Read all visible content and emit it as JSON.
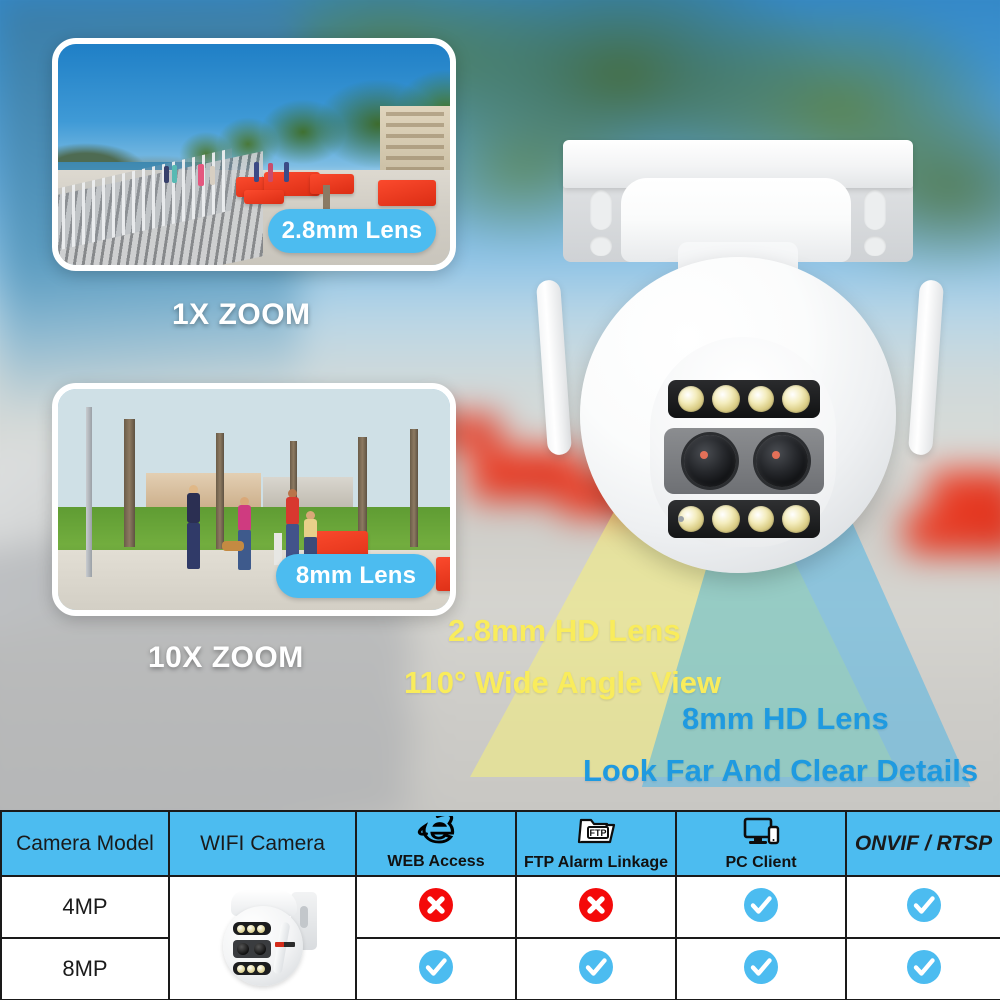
{
  "hero": {
    "previews": [
      {
        "id": "1x",
        "zoom_label": "1X ZOOM",
        "pill_label": "2.8mm Lens",
        "scene": "riverside promenade with boardwalk, red lounge furniture and trees"
      },
      {
        "id": "10x",
        "zoom_label": "10X ZOOM",
        "pill_label": "8mm Lens",
        "scene": "park lawn with people walking, trees and red bench"
      }
    ],
    "callouts": [
      {
        "text": "2.8mm HD Lens",
        "color": "#f9ec5c"
      },
      {
        "text": "110° Wide Angle View",
        "color": "#f9ec5c"
      },
      {
        "text": "8mm HD Lens",
        "color": "#1f9ae0"
      },
      {
        "text": "Look Far And Clear Details",
        "color": "#1f9ae0"
      }
    ],
    "cones": [
      {
        "name": "wide-angle-beam",
        "color": "#f6f07a"
      },
      {
        "name": "telephoto-beam",
        "color": "#46b3e8"
      }
    ],
    "camera": {
      "name": "dual-lens-ptz-wifi-camera",
      "body_color": "#ffffff"
    }
  },
  "table": {
    "headers": [
      {
        "label": "Camera Model",
        "icon": null,
        "icon_label": null,
        "style": "plain"
      },
      {
        "label": "WIFI Camera",
        "icon": null,
        "icon_label": null,
        "style": "plain"
      },
      {
        "label": "WEB Access",
        "icon": "ie-browser-icon",
        "icon_label": "WEB Access",
        "style": "icon"
      },
      {
        "label": "FTP Alarm Linkage",
        "icon": "ftp-folder-icon",
        "icon_label": "FTP Alarm Linkage",
        "style": "icon"
      },
      {
        "label": "PC Client",
        "icon": "pc-monitor-icon",
        "icon_label": "PC Client",
        "style": "icon"
      },
      {
        "label": "ONVIF / RTSP",
        "icon": null,
        "icon_label": null,
        "style": "italic"
      }
    ],
    "rows": [
      {
        "model": "4MP",
        "web_access": "no",
        "ftp_alarm_linkage": "no",
        "pc_client": "yes",
        "onvif_rtsp": "yes"
      },
      {
        "model": "8MP",
        "web_access": "yes",
        "ftp_alarm_linkage": "yes",
        "pc_client": "yes",
        "onvif_rtsp": "yes"
      }
    ],
    "camera_cell": {
      "name": "wifi-camera-product-photo"
    },
    "marks": {
      "yes_color": "#4cbcf0",
      "no_color": "#f40a0a"
    },
    "header_bg": "#4cbcf0"
  }
}
